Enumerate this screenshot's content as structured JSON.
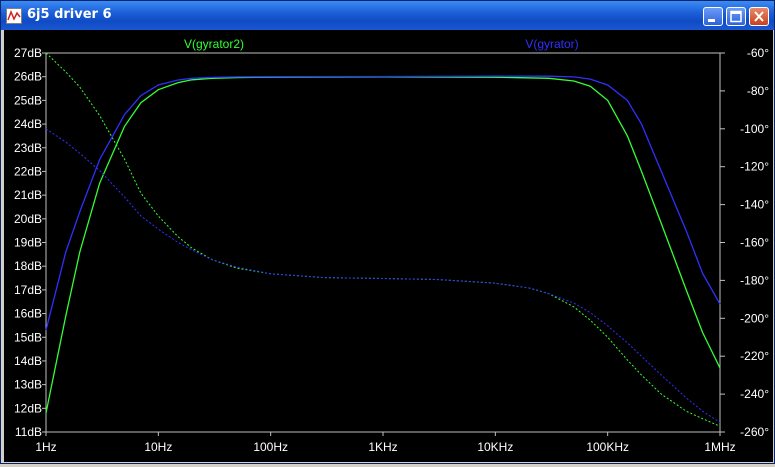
{
  "window": {
    "title": "6j5 driver 6",
    "icon": "waveform-icon",
    "buttons": [
      "minimize-icon",
      "maximize-icon",
      "close-icon"
    ]
  },
  "colors": {
    "plot_background": "#000000",
    "axis": "#c0c0c0",
    "label": "#ffffff",
    "series_green": "#33ff33",
    "series_blue": "#3030ff"
  },
  "chart_data": {
    "type": "line",
    "x_scale": "log",
    "x_ticks": [
      "1Hz",
      "10Hz",
      "100Hz",
      "1KHz",
      "10KHz",
      "100KHz",
      "1MHz"
    ],
    "x_tick_values": [
      1,
      10,
      100,
      1000,
      10000,
      100000,
      1000000
    ],
    "xlim": [
      1,
      1000000
    ],
    "y_left_ticks": [
      "27dB",
      "26dB",
      "25dB",
      "24dB",
      "23dB",
      "22dB",
      "21dB",
      "20dB",
      "19dB",
      "18dB",
      "17dB",
      "16dB",
      "15dB",
      "14dB",
      "13dB",
      "12dB",
      "11dB"
    ],
    "y_left_tick_values": [
      27,
      26,
      25,
      24,
      23,
      22,
      21,
      20,
      19,
      18,
      17,
      16,
      15,
      14,
      13,
      12,
      11
    ],
    "ylim_left": [
      11,
      27
    ],
    "y_right_ticks": [
      "-60°",
      "-80°",
      "-100°",
      "-120°",
      "-140°",
      "-160°",
      "-180°",
      "-200°",
      "-220°",
      "-240°",
      "-260°"
    ],
    "y_right_tick_values": [
      -60,
      -80,
      -100,
      -120,
      -140,
      -160,
      -180,
      -200,
      -220,
      -240,
      -260
    ],
    "ylim_right": [
      -260,
      -60
    ],
    "grid": false,
    "series": [
      {
        "name": "V(gyrator2)",
        "color": "#33ff33",
        "magnitude_db": [
          [
            1,
            11.8
          ],
          [
            1.5,
            15.9
          ],
          [
            2,
            18.6
          ],
          [
            3,
            21.5
          ],
          [
            5,
            23.9
          ],
          [
            7,
            24.9
          ],
          [
            10,
            25.45
          ],
          [
            15,
            25.75
          ],
          [
            20,
            25.87
          ],
          [
            30,
            25.93
          ],
          [
            50,
            25.96
          ],
          [
            100,
            25.98
          ],
          [
            1000,
            25.99
          ],
          [
            10000,
            25.98
          ],
          [
            30000,
            25.93
          ],
          [
            50000,
            25.82
          ],
          [
            70000,
            25.6
          ],
          [
            100000,
            25.0
          ],
          [
            150000,
            23.5
          ],
          [
            200000,
            22.0
          ],
          [
            300000,
            19.8
          ],
          [
            500000,
            17.0
          ],
          [
            700000,
            15.2
          ],
          [
            1000000,
            13.7
          ]
        ],
        "phase_deg": [
          [
            1,
            -60
          ],
          [
            1.5,
            -70
          ],
          [
            2,
            -78
          ],
          [
            3,
            -93
          ],
          [
            5,
            -116
          ],
          [
            7,
            -134
          ],
          [
            10,
            -146
          ],
          [
            15,
            -157
          ],
          [
            20,
            -163
          ],
          [
            30,
            -169
          ],
          [
            50,
            -173.5
          ],
          [
            100,
            -176.5
          ],
          [
            300,
            -178.5
          ],
          [
            1000,
            -179
          ],
          [
            3000,
            -179.5
          ],
          [
            10000,
            -181.5
          ],
          [
            20000,
            -184
          ],
          [
            30000,
            -187
          ],
          [
            50000,
            -194
          ],
          [
            70000,
            -201
          ],
          [
            100000,
            -210
          ],
          [
            150000,
            -222
          ],
          [
            200000,
            -230
          ],
          [
            300000,
            -240
          ],
          [
            500000,
            -249
          ],
          [
            700000,
            -253
          ],
          [
            1000000,
            -257
          ]
        ]
      },
      {
        "name": "V(gyrator)",
        "color": "#3030ff",
        "magnitude_db": [
          [
            1,
            15.3
          ],
          [
            1.5,
            18.6
          ],
          [
            2,
            20.3
          ],
          [
            3,
            22.5
          ],
          [
            5,
            24.4
          ],
          [
            7,
            25.2
          ],
          [
            10,
            25.65
          ],
          [
            15,
            25.86
          ],
          [
            20,
            25.93
          ],
          [
            30,
            25.97
          ],
          [
            50,
            25.99
          ],
          [
            100,
            26.0
          ],
          [
            1000,
            26.01
          ],
          [
            10000,
            26.02
          ],
          [
            30000,
            26.02
          ],
          [
            50000,
            25.99
          ],
          [
            70000,
            25.9
          ],
          [
            100000,
            25.65
          ],
          [
            150000,
            25.0
          ],
          [
            200000,
            24.0
          ],
          [
            300000,
            22.0
          ],
          [
            500000,
            19.5
          ],
          [
            700000,
            17.7
          ],
          [
            1000000,
            16.4
          ]
        ],
        "phase_deg": [
          [
            1,
            -100
          ],
          [
            1.5,
            -107
          ],
          [
            2,
            -113
          ],
          [
            3,
            -122
          ],
          [
            5,
            -136
          ],
          [
            7,
            -146
          ],
          [
            10,
            -153
          ],
          [
            15,
            -160
          ],
          [
            20,
            -164
          ],
          [
            30,
            -169
          ],
          [
            50,
            -173
          ],
          [
            100,
            -176.5
          ],
          [
            300,
            -178.5
          ],
          [
            1000,
            -179
          ],
          [
            3000,
            -179.5
          ],
          [
            10000,
            -181.5
          ],
          [
            20000,
            -184
          ],
          [
            30000,
            -187
          ],
          [
            50000,
            -192
          ],
          [
            70000,
            -197
          ],
          [
            100000,
            -204
          ],
          [
            150000,
            -213
          ],
          [
            200000,
            -220
          ],
          [
            300000,
            -230
          ],
          [
            500000,
            -242
          ],
          [
            700000,
            -249
          ],
          [
            1000000,
            -255
          ]
        ]
      }
    ]
  }
}
